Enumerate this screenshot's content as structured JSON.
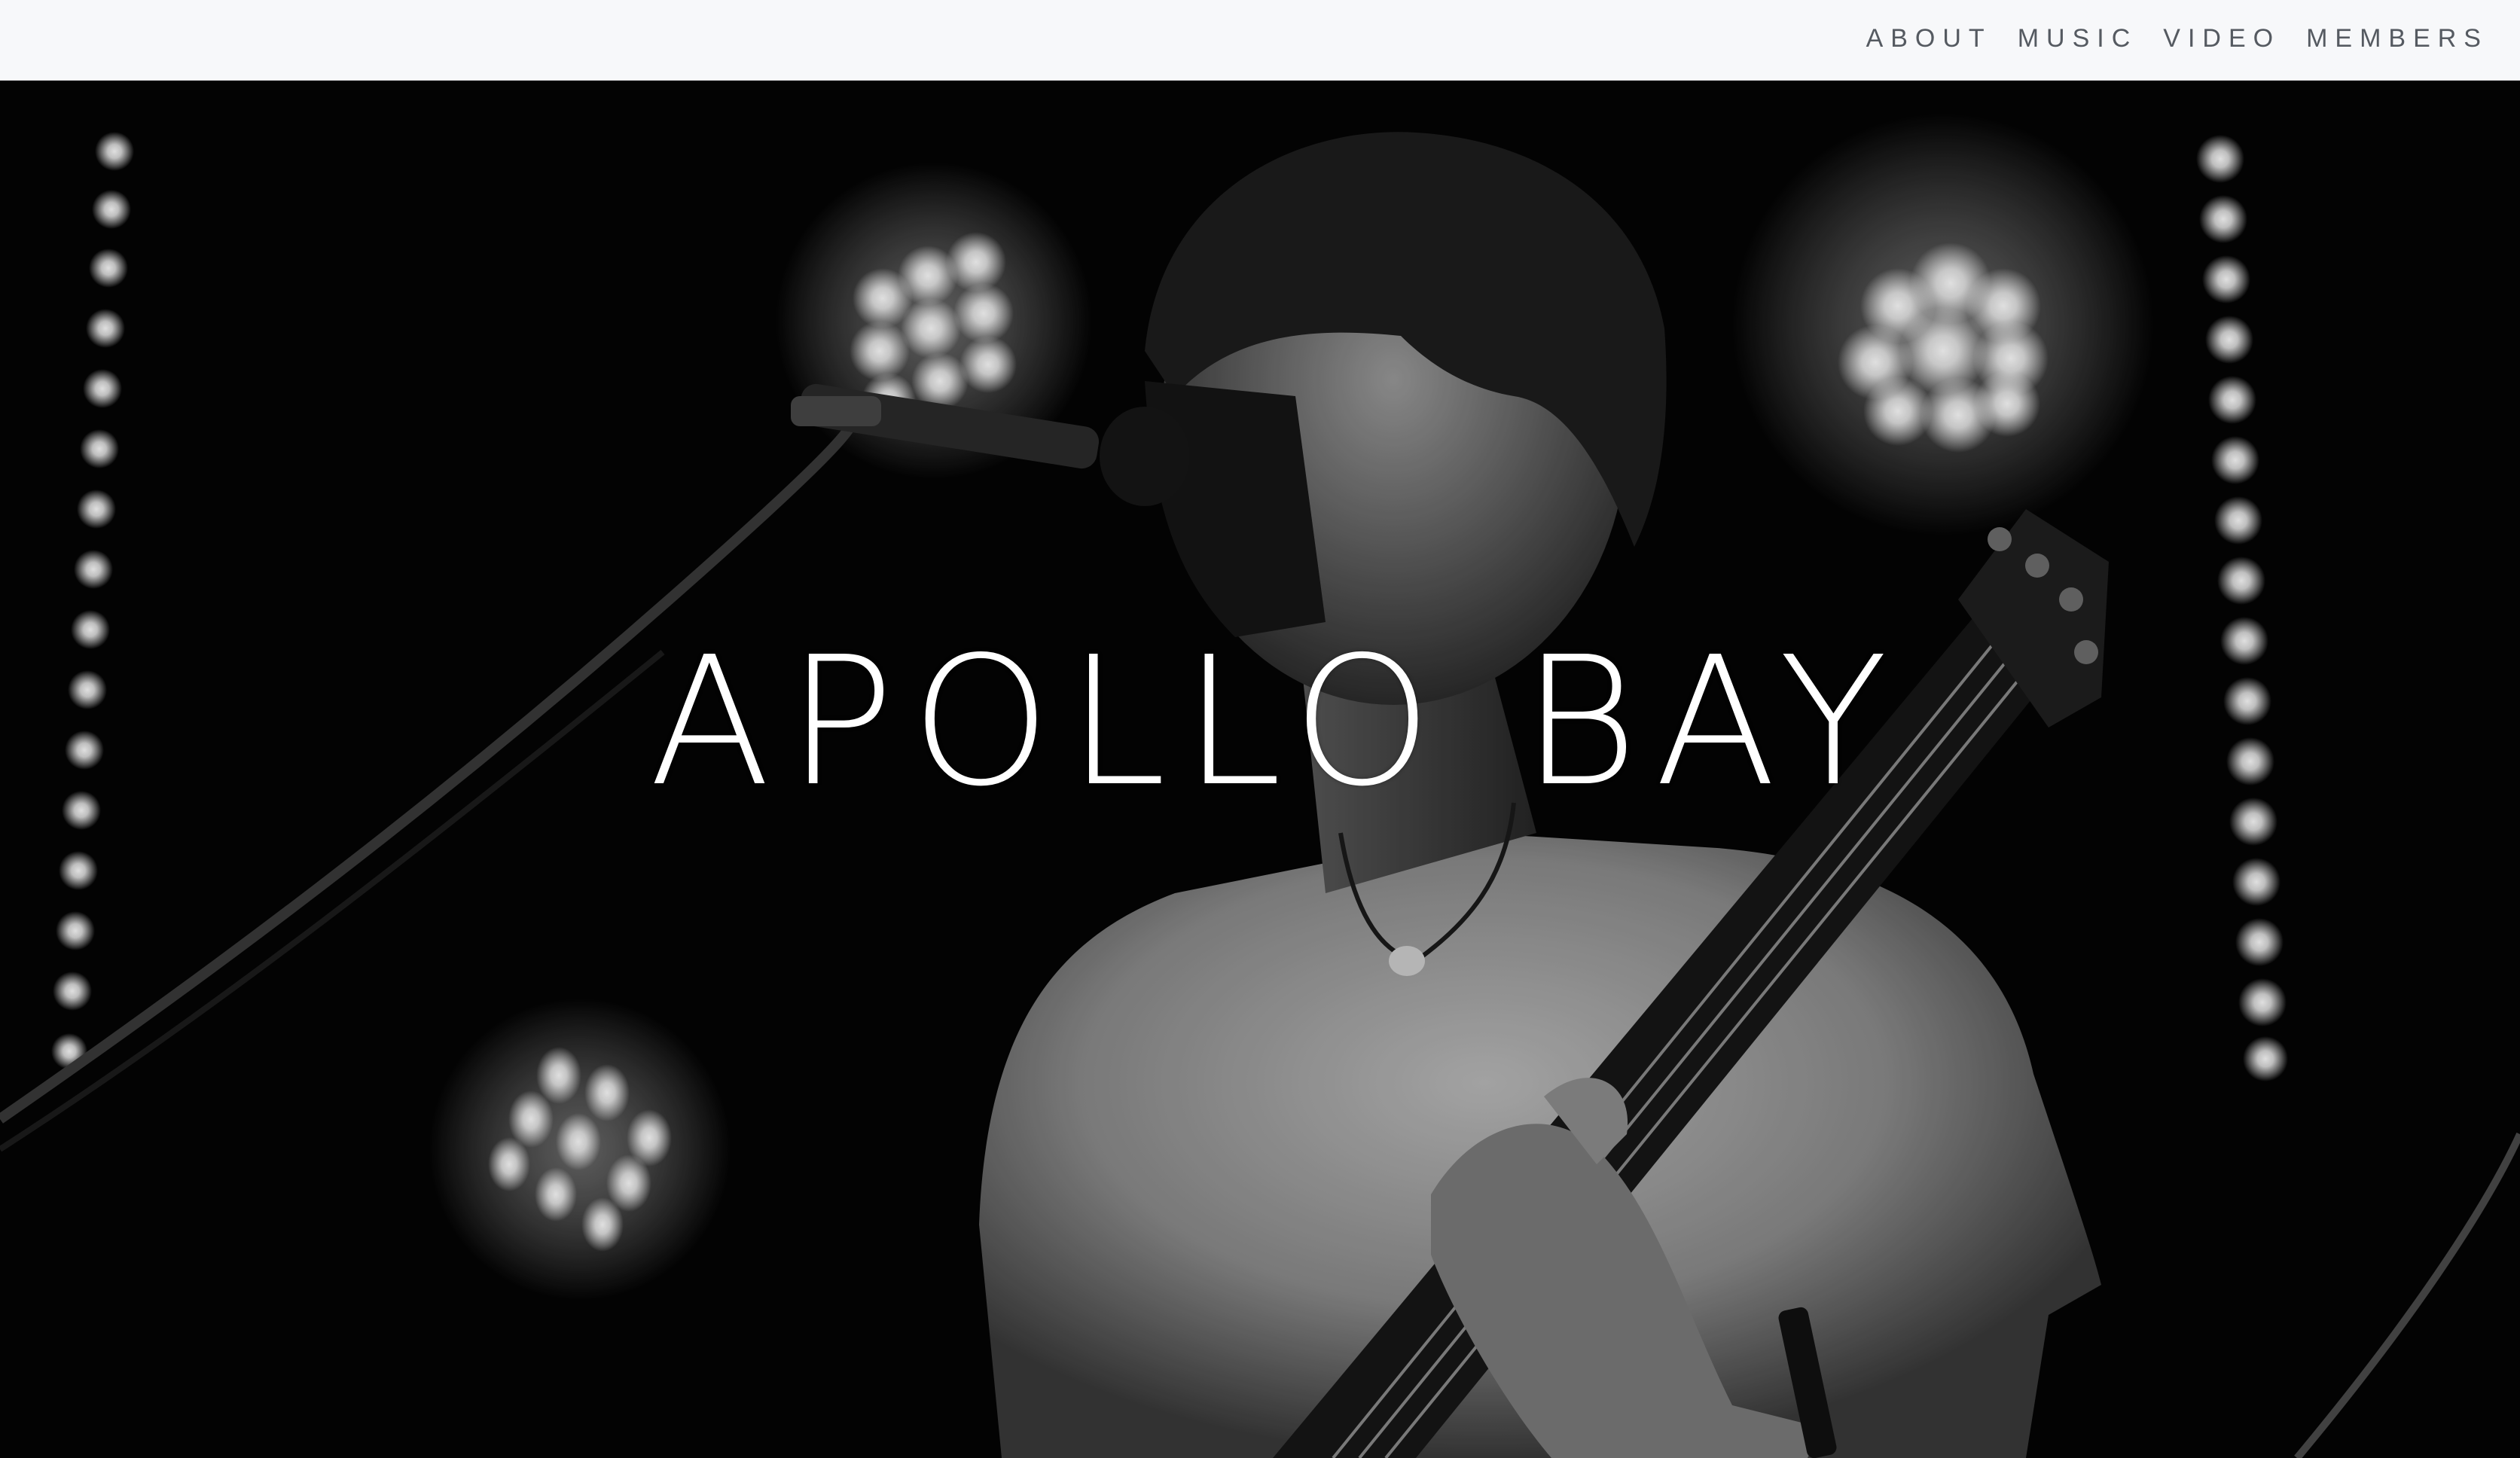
{
  "nav": {
    "items": [
      {
        "label": "ABOUT"
      },
      {
        "label": "MUSIC"
      },
      {
        "label": "VIDEO"
      },
      {
        "label": "MEMBERS"
      }
    ]
  },
  "hero": {
    "title": "APOLLO BAY",
    "image": "black-and-white photo of a guitarist singing into a microphone on stage with bright stage lights"
  },
  "colors": {
    "topbar_bg": "#f7f8fa",
    "nav_text": "#555a61",
    "hero_bg": "#030303",
    "title": "#ffffff"
  }
}
